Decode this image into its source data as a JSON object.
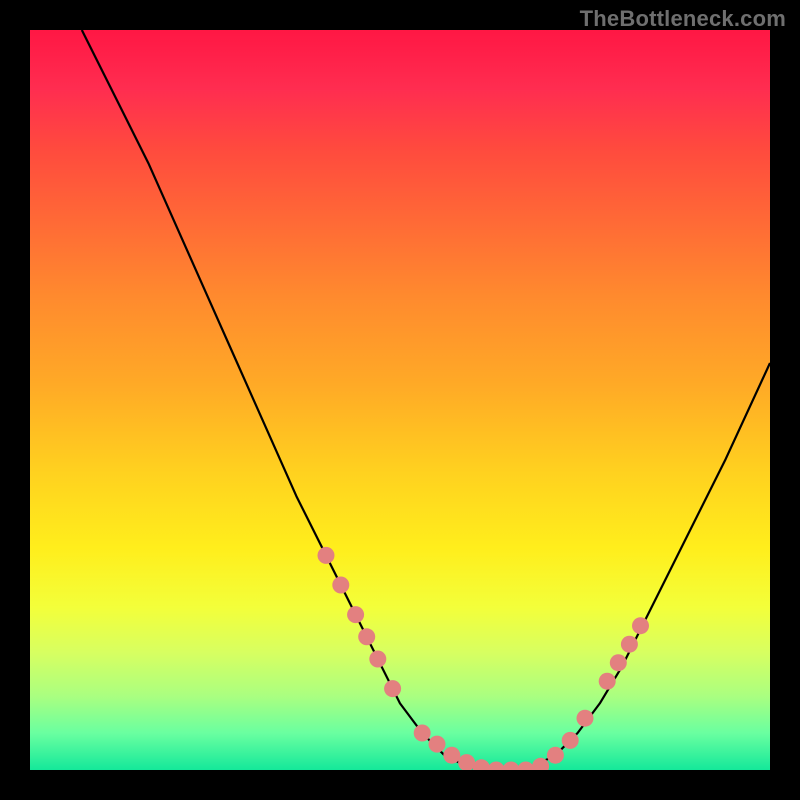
{
  "watermark": "TheBottleneck.com",
  "colors": {
    "curve": "#000000",
    "marker": "#e38080",
    "gradient_top": "#ff1744",
    "gradient_mid": "#ffee1c",
    "gradient_bottom": "#14e89a"
  },
  "chart_data": {
    "type": "line",
    "title": "",
    "xlabel": "",
    "ylabel": "",
    "xlim": [
      0,
      100
    ],
    "ylim": [
      0,
      100
    ],
    "grid": false,
    "legend": false,
    "series": [
      {
        "name": "bottleneck-curve",
        "x": [
          7,
          10,
          13,
          16,
          20,
          24,
          28,
          32,
          36,
          40,
          44,
          47,
          50,
          53,
          56,
          59,
          62,
          65,
          68,
          71,
          74,
          77,
          80,
          83,
          86,
          90,
          94,
          100
        ],
        "y": [
          100,
          94,
          88,
          82,
          73,
          64,
          55,
          46,
          37,
          29,
          21,
          15,
          9,
          5,
          2,
          0.5,
          0,
          0,
          0.5,
          2,
          5,
          9,
          14,
          20,
          26,
          34,
          42,
          55
        ]
      }
    ],
    "markers": {
      "name": "highlighted-points",
      "x": [
        40,
        42,
        44,
        45.5,
        47,
        49,
        53,
        55,
        57,
        59,
        61,
        63,
        65,
        67,
        69,
        71,
        73,
        75,
        78,
        79.5,
        81,
        82.5
      ],
      "y": [
        29,
        25,
        21,
        18,
        15,
        11,
        5,
        3.5,
        2,
        1,
        0.3,
        0,
        0,
        0,
        0.5,
        2,
        4,
        7,
        12,
        14.5,
        17,
        19.5
      ]
    }
  }
}
